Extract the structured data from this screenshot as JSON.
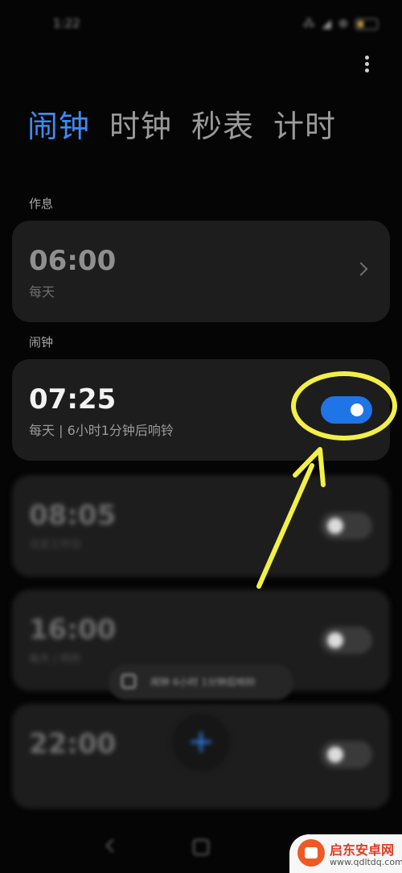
{
  "status_bar": {
    "time": "1:22",
    "icons": "⁂ ◢ ⊕"
  },
  "tabs": [
    {
      "label": "闹钟",
      "active": true
    },
    {
      "label": "时钟",
      "active": false
    },
    {
      "label": "秒表",
      "active": false
    },
    {
      "label": "计时",
      "active": false
    }
  ],
  "sleep_section": {
    "label": "作息",
    "time": "06:00",
    "repeat": "每天"
  },
  "alarm_section": {
    "label": "闹钟",
    "alarms": [
      {
        "time": "07:25",
        "desc": "每天 | 6小时1分钟后响铃",
        "enabled": true
      },
      {
        "time": "08:05",
        "desc": "法定工作日",
        "enabled": false
      },
      {
        "time": "16:00",
        "desc": "每天 | 响铃",
        "enabled": false
      },
      {
        "time": "22:00",
        "desc": "",
        "enabled": false
      }
    ]
  },
  "toast": {
    "text": "闹钟 6小时 1分钟后响铃"
  },
  "fab": {
    "label": "+"
  },
  "watermark": {
    "title": "启东安卓网",
    "url": "www.qdltdq.com"
  },
  "colors": {
    "accent": "#3a8ef6",
    "toggle_on": "#1f74e6",
    "annotation": "#f2f047"
  }
}
